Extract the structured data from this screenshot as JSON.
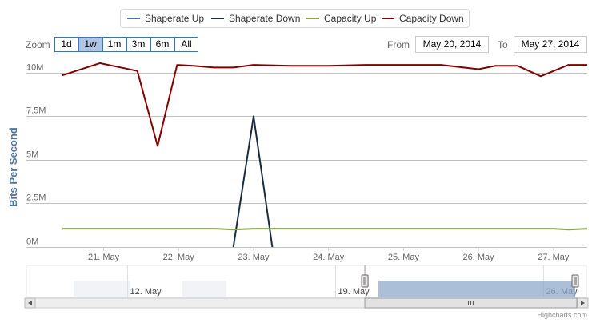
{
  "legend": {
    "items": [
      {
        "label": "Shaperate Up",
        "color": "#4572a7"
      },
      {
        "label": "Shaperate Down",
        "color": "#1a2b3f"
      },
      {
        "label": "Capacity Up",
        "color": "#89a54e"
      },
      {
        "label": "Capacity Down",
        "color": "#800000"
      }
    ]
  },
  "range_selector": {
    "zoom_label": "Zoom",
    "buttons": [
      "1d",
      "1w",
      "1m",
      "3m",
      "6m",
      "All"
    ],
    "selected": "1w",
    "from_label": "From",
    "from_value": "May 20, 2014",
    "to_label": "To",
    "to_value": "May 27, 2014"
  },
  "credits": "Highcharts.com",
  "chart_data": {
    "type": "line",
    "ylabel": "Bits Per Second",
    "yticks": [
      {
        "label": "0M",
        "value": 0
      },
      {
        "label": "2.5M",
        "value": 2500000
      },
      {
        "label": "5M",
        "value": 5000000
      },
      {
        "label": "7.5M",
        "value": 7500000
      },
      {
        "label": "10M",
        "value": 10000000
      }
    ],
    "ylim": [
      0,
      10500000
    ],
    "xticks": [
      {
        "label": "21. May",
        "value": 21
      },
      {
        "label": "22. May",
        "value": 22
      },
      {
        "label": "23. May",
        "value": 23
      },
      {
        "label": "24. May",
        "value": 24
      },
      {
        "label": "25. May",
        "value": 25
      },
      {
        "label": "26. May",
        "value": 26
      },
      {
        "label": "27. May",
        "value": 27
      }
    ],
    "xlim": [
      20.45,
      27.45
    ],
    "grid": true,
    "series": [
      {
        "name": "Shaperate Up",
        "color": "#4572a7",
        "x": [],
        "y": []
      },
      {
        "name": "Shaperate Down",
        "color": "#1a2b3f",
        "x": [
          22.73,
          23.0,
          23.25
        ],
        "y": [
          0,
          7500000,
          0
        ]
      },
      {
        "name": "Capacity Up",
        "color": "#89a54e",
        "x": [
          20.45,
          21.0,
          21.5,
          22.0,
          22.5,
          22.73,
          23.0,
          23.5,
          24.0,
          24.5,
          25.0,
          25.5,
          26.0,
          26.5,
          27.0,
          27.2,
          27.45
        ],
        "y": [
          1050000,
          1050000,
          1050000,
          1050000,
          1050000,
          1000000,
          1050000,
          1050000,
          1050000,
          1050000,
          1050000,
          1050000,
          1050000,
          1050000,
          1050000,
          1000000,
          1050000
        ]
      },
      {
        "name": "Capacity Down",
        "color": "#800000",
        "x": [
          20.45,
          20.95,
          21.45,
          21.72,
          21.98,
          22.2,
          22.47,
          22.73,
          23.0,
          23.5,
          24.0,
          24.5,
          25.0,
          25.5,
          26.0,
          26.23,
          26.52,
          26.83,
          27.2,
          27.45
        ],
        "y": [
          9850000,
          10550000,
          10100000,
          5800000,
          10450000,
          10400000,
          10300000,
          10300000,
          10450000,
          10400000,
          10400000,
          10450000,
          10450000,
          10450000,
          10200000,
          10400000,
          10400000,
          9800000,
          10450000,
          10450000
        ]
      }
    ]
  },
  "navigator": {
    "labels": [
      {
        "label": "12. May",
        "value": 12
      },
      {
        "label": "19. May",
        "value": 19
      },
      {
        "label": "26. May",
        "value": 26
      }
    ],
    "range": [
      8.6,
      27.45
    ],
    "band_start": 20.45,
    "band_end": 27.45
  }
}
